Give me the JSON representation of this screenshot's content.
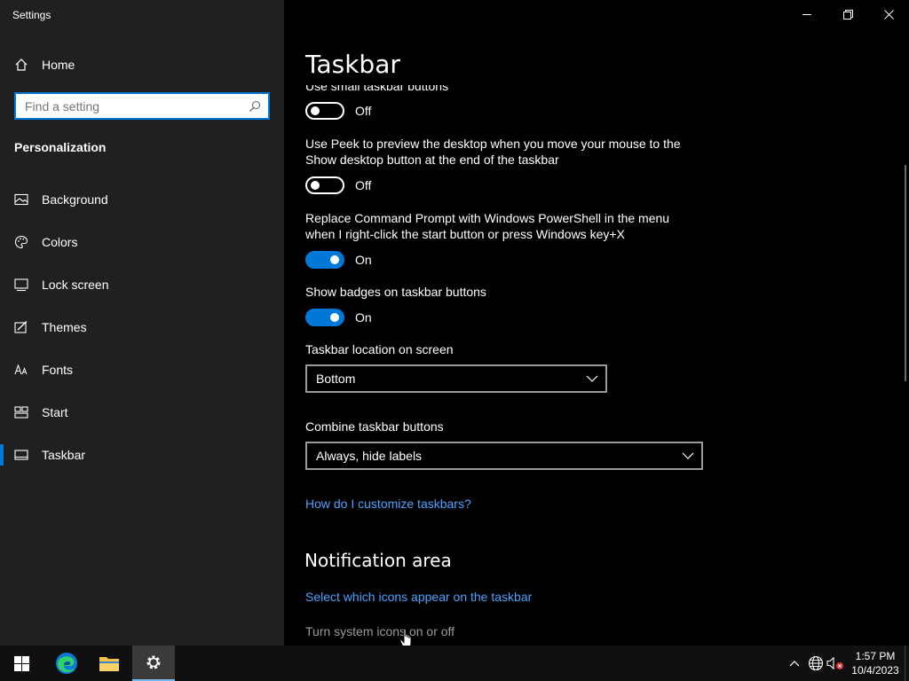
{
  "window": {
    "app_title": "Settings",
    "minimize_icon": "minimize-icon",
    "restore_icon": "restore-icon",
    "close_icon": "close-icon"
  },
  "sidebar": {
    "home_label": "Home",
    "search_placeholder": "Find a setting",
    "section_title": "Personalization",
    "items": [
      {
        "label": "Background",
        "icon": "image-icon"
      },
      {
        "label": "Colors",
        "icon": "palette-icon"
      },
      {
        "label": "Lock screen",
        "icon": "lock-screen-icon"
      },
      {
        "label": "Themes",
        "icon": "themes-icon"
      },
      {
        "label": "Fonts",
        "icon": "fonts-icon"
      },
      {
        "label": "Start",
        "icon": "start-icon"
      },
      {
        "label": "Taskbar",
        "icon": "taskbar-icon",
        "active": true
      }
    ]
  },
  "main": {
    "title": "Taskbar",
    "settings": [
      {
        "label": "Use small taskbar buttons",
        "state": "Off"
      },
      {
        "label": "Use Peek to preview the desktop when you move your mouse to the Show desktop button at the end of the taskbar",
        "state": "Off"
      },
      {
        "label": "Replace Command Prompt with Windows PowerShell in the menu when I right-click the start button or press Windows key+X",
        "state": "On"
      },
      {
        "label": "Show badges on taskbar buttons",
        "state": "On"
      }
    ],
    "location": {
      "label": "Taskbar location on screen",
      "value": "Bottom"
    },
    "combine": {
      "label": "Combine taskbar buttons",
      "value": "Always, hide labels"
    },
    "help_link": "How do I customize taskbars?",
    "notification": {
      "heading": "Notification area",
      "select_icons_link": "Select which icons appear on the taskbar",
      "system_icons_link": "Turn system icons on or off"
    }
  },
  "taskbar": {
    "time": "1:57 PM",
    "date": "10/4/2023"
  },
  "colors": {
    "accent": "#0078d7",
    "link": "#4ca2ff",
    "sidebar_bg": "#202020"
  }
}
